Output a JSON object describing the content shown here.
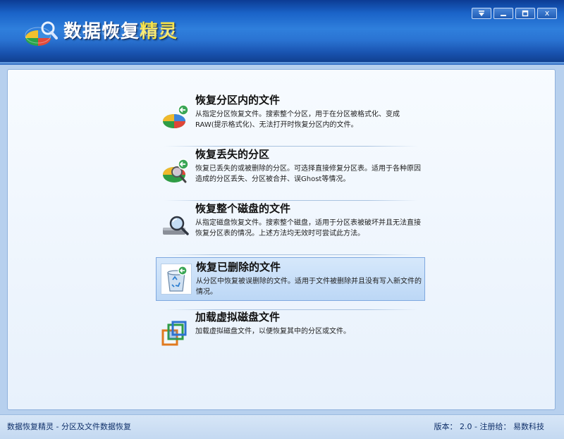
{
  "app": {
    "title_main": "数据恢复",
    "title_accent": "精灵",
    "title_full": "数据恢复精灵"
  },
  "window_controls": {
    "menu_icon": "chevron-down-icon",
    "minimize_icon": "minimize-icon",
    "maximize_icon": "maximize-icon",
    "close_label": "x"
  },
  "options": [
    {
      "title": "恢复分区内的文件",
      "desc": "从指定分区恢复文件。搜索整个分区，用于在分区被格式化、变成RAW(提示格式化)、无法打开时恢复分区内的文件。",
      "icon": "pie-chart-restore-icon"
    },
    {
      "title": "恢复丢失的分区",
      "desc": "恢复已丢失的或被删除的分区。可选择直接修复分区表。适用于各种原因造成的分区丢失、分区被合并、误Ghost等情况。",
      "icon": "partition-search-icon"
    },
    {
      "title": "恢复整个磁盘的文件",
      "desc": "从指定磁盘恢复文件。搜索整个磁盘，适用于分区表被破坏并且无法直接恢复分区表的情况。上述方法均无效时可尝试此方法。",
      "icon": "disk-search-icon"
    },
    {
      "title": "恢复已删除的文件",
      "desc": "从分区中恢复被误删除的文件。适用于文件被删除并且没有写入新文件的情况。",
      "icon": "recycle-bin-restore-icon",
      "selected": true
    },
    {
      "title": "加载虚拟磁盘文件",
      "desc": "加载虚拟磁盘文件，以便恢复其中的分区或文件。",
      "icon": "virtual-disk-icon"
    }
  ],
  "status": {
    "left": "数据恢复精灵 - 分区及文件数据恢复",
    "right": "版本： 2.0 - 注册给： 易数科技"
  },
  "colors": {
    "titlebar": "#1a63c8",
    "title_accent": "#f4e24a",
    "selected_bg": "#bcd7f6",
    "status_text": "#10306a"
  }
}
